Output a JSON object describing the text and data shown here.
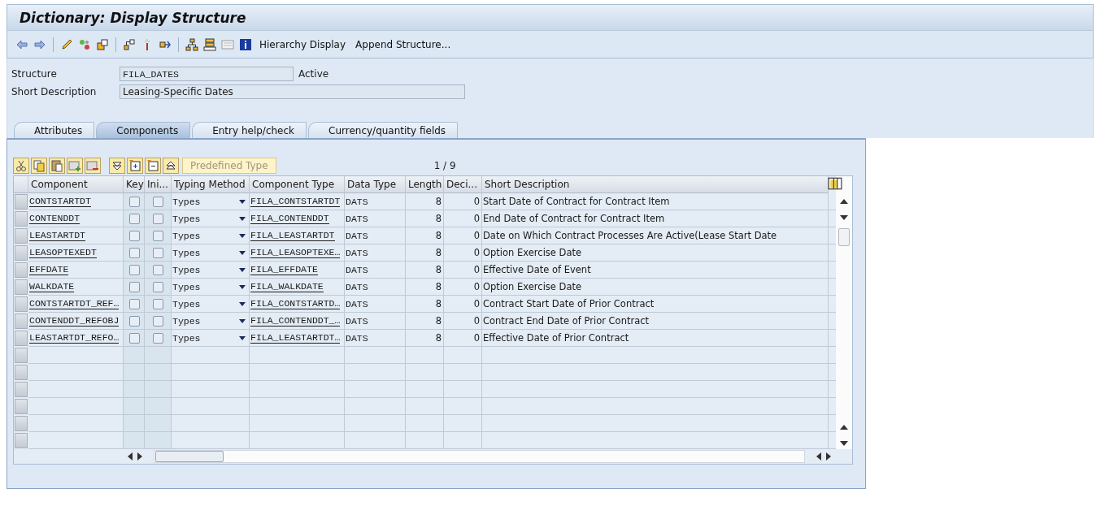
{
  "window": {
    "title": "Dictionary: Display Structure"
  },
  "toolbar": {
    "buttons": [
      "Hierarchy Display",
      "Append Structure..."
    ]
  },
  "header": {
    "structure_label": "Structure",
    "structure_value": "FILA_DATES",
    "status": "Active",
    "description_label": "Short Description",
    "description_value": "Leasing-Specific Dates"
  },
  "tabs": [
    {
      "label": "Attributes",
      "selected": false
    },
    {
      "label": "Components",
      "selected": true
    },
    {
      "label": "Entry help/check",
      "selected": false
    },
    {
      "label": "Currency/quantity fields",
      "selected": false
    }
  ],
  "table_toolbar": {
    "predefined_type": {
      "label": "Predefined Type",
      "disabled": true
    },
    "position": "1 / 9"
  },
  "table": {
    "columns": [
      "Component",
      "Key",
      "Ini...",
      "Typing Method",
      "Component Type",
      "Data Type",
      "Length",
      "Deci...",
      "Short Description"
    ],
    "rows": [
      {
        "component": "CONTSTARTDT",
        "key": false,
        "initial": false,
        "typing_method": "Types",
        "component_type": "FILA_CONTSTARTDT",
        "data_type": "DATS",
        "length": "8",
        "decimals": "0",
        "description": "Start Date of Contract for Contract Item"
      },
      {
        "component": "CONTENDDT",
        "key": false,
        "initial": false,
        "typing_method": "Types",
        "component_type": "FILA_CONTENDDT",
        "data_type": "DATS",
        "length": "8",
        "decimals": "0",
        "description": "End Date of Contract for Contract Item"
      },
      {
        "component": "LEASTARTDT",
        "key": false,
        "initial": false,
        "typing_method": "Types",
        "component_type": "FILA_LEASTARTDT",
        "data_type": "DATS",
        "length": "8",
        "decimals": "0",
        "description": "Date on Which Contract Processes Are Active(Lease Start Date"
      },
      {
        "component": "LEASOPTEXEDT",
        "key": false,
        "initial": false,
        "typing_method": "Types",
        "component_type": "FILA_LEASOPTEXE…",
        "data_type": "DATS",
        "length": "8",
        "decimals": "0",
        "description": "Option Exercise Date"
      },
      {
        "component": "EFFDATE",
        "key": false,
        "initial": false,
        "typing_method": "Types",
        "component_type": "FILA_EFFDATE",
        "data_type": "DATS",
        "length": "8",
        "decimals": "0",
        "description": "Effective Date of Event"
      },
      {
        "component": "WALKDATE",
        "key": false,
        "initial": false,
        "typing_method": "Types",
        "component_type": "FILA_WALKDATE",
        "data_type": "DATS",
        "length": "8",
        "decimals": "0",
        "description": "Option Exercise Date"
      },
      {
        "component": "CONTSTARTDT_REF…",
        "key": false,
        "initial": false,
        "typing_method": "Types",
        "component_type": "FILA_CONTSTARTD…",
        "data_type": "DATS",
        "length": "8",
        "decimals": "0",
        "description": "Contract Start Date of Prior Contract"
      },
      {
        "component": "CONTENDDT_REFOBJ",
        "key": false,
        "initial": false,
        "typing_method": "Types",
        "component_type": "FILA_CONTENDDT_…",
        "data_type": "DATS",
        "length": "8",
        "decimals": "0",
        "description": "Contract End Date of Prior Contract"
      },
      {
        "component": "LEASTARTDT_REFO…",
        "key": false,
        "initial": false,
        "typing_method": "Types",
        "component_type": "FILA_LEASTARTDT…",
        "data_type": "DATS",
        "length": "8",
        "decimals": "0",
        "description": "Effective Date of Prior Contract"
      }
    ]
  }
}
